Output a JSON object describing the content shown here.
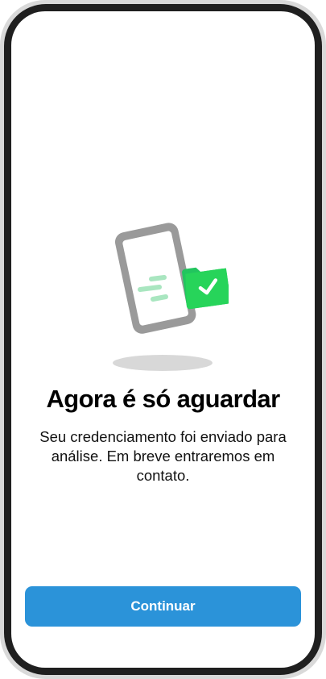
{
  "confirmation": {
    "title": "Agora é só aguardar",
    "message": "Seu credenciamento foi enviado para análise. Em breve entraremos em contato.",
    "illustration_icon": "phone-with-approved-folder-icon"
  },
  "actions": {
    "continue_label": "Continuar"
  },
  "colors": {
    "accent": "#2b93d9",
    "success_green": "#27d45a",
    "illustration_gray": "#9a9a9a"
  }
}
